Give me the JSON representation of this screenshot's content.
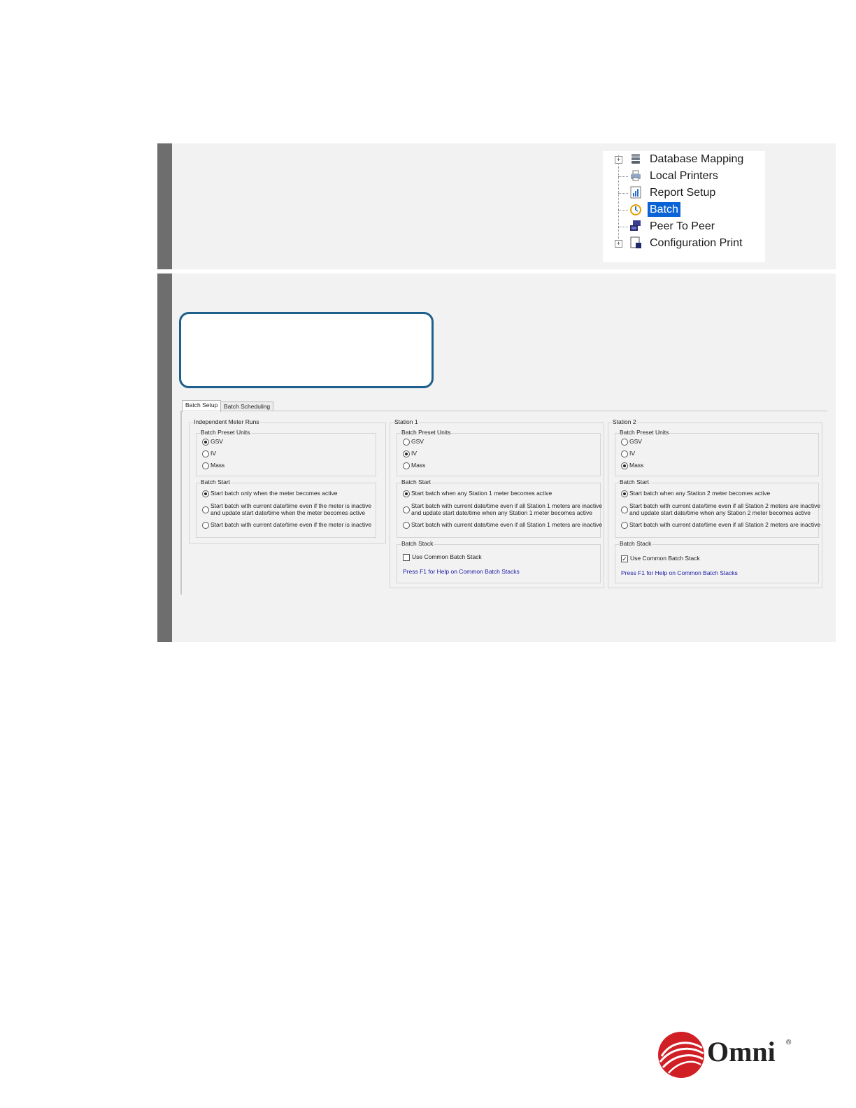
{
  "tree": {
    "items": [
      {
        "label": "Database Mapping",
        "icon": "database-icon",
        "expandable": true
      },
      {
        "label": "Local Printers",
        "icon": "printer-icon",
        "expandable": false
      },
      {
        "label": "Report Setup",
        "icon": "report-icon",
        "expandable": false
      },
      {
        "label": "Batch",
        "icon": "batch-clock-icon",
        "expandable": false,
        "selected": true
      },
      {
        "label": "Peer To Peer",
        "icon": "network-icon",
        "expandable": false
      },
      {
        "label": "Configuration Print",
        "icon": "document-icon",
        "expandable": true
      }
    ]
  },
  "tabs": [
    "Batch Setup",
    "Batch Scheduling"
  ],
  "groups": {
    "independent": {
      "title": "Independent Meter Runs",
      "preset_title": "Batch Preset Units",
      "preset_options": [
        "GSV",
        "IV",
        "Mass"
      ],
      "preset_selected": 0,
      "start_title": "Batch Start",
      "start_options": [
        "Start batch only when the meter becomes active",
        "Start batch with current date/time even if the meter is inactive\nand update start date/time when the meter becomes active",
        "Start batch with current date/time even if the meter is inactive"
      ],
      "start_selected": 0
    },
    "station1": {
      "title": "Station 1",
      "preset_title": "Batch Preset Units",
      "preset_options": [
        "GSV",
        "IV",
        "Mass"
      ],
      "preset_selected": 1,
      "start_title": "Batch Start",
      "start_options": [
        "Start batch when any Station 1 meter becomes active",
        "Start batch with current date/time even if all Station 1 meters are inactive\nand update start date/time when any Station 1 meter becomes active",
        "Start batch with current date/time even if all Station 1 meters are inactive"
      ],
      "start_selected": 0,
      "stack_title": "Batch Stack",
      "stack_checkbox": "Use Common Batch Stack",
      "stack_checked": false,
      "help_link": "Press F1 for Help on Common Batch Stacks"
    },
    "station2": {
      "title": "Station 2",
      "preset_title": "Batch Preset Units",
      "preset_options": [
        "GSV",
        "IV",
        "Mass"
      ],
      "preset_selected": 2,
      "start_title": "Batch Start",
      "start_options": [
        "Start batch when any Station 2 meter becomes active",
        "Start batch with current date/time even if all Station 2 meters are inactive\nand update start date/time when any Station 2 meter becomes active",
        "Start batch with current date/time even if all Station 2 meters are inactive"
      ],
      "start_selected": 0,
      "stack_title": "Batch Stack",
      "stack_checkbox": "Use Common Batch Stack",
      "stack_checked": true,
      "help_link": "Press F1 for Help on Common Batch Stacks"
    }
  },
  "logo": {
    "text": "Omni",
    "reg": "®"
  },
  "colors": {
    "selection": "#0a63d6",
    "step_bar": "#6e6e6e",
    "callout_border": "#1f5f8b",
    "logo_red": "#d11f26"
  }
}
